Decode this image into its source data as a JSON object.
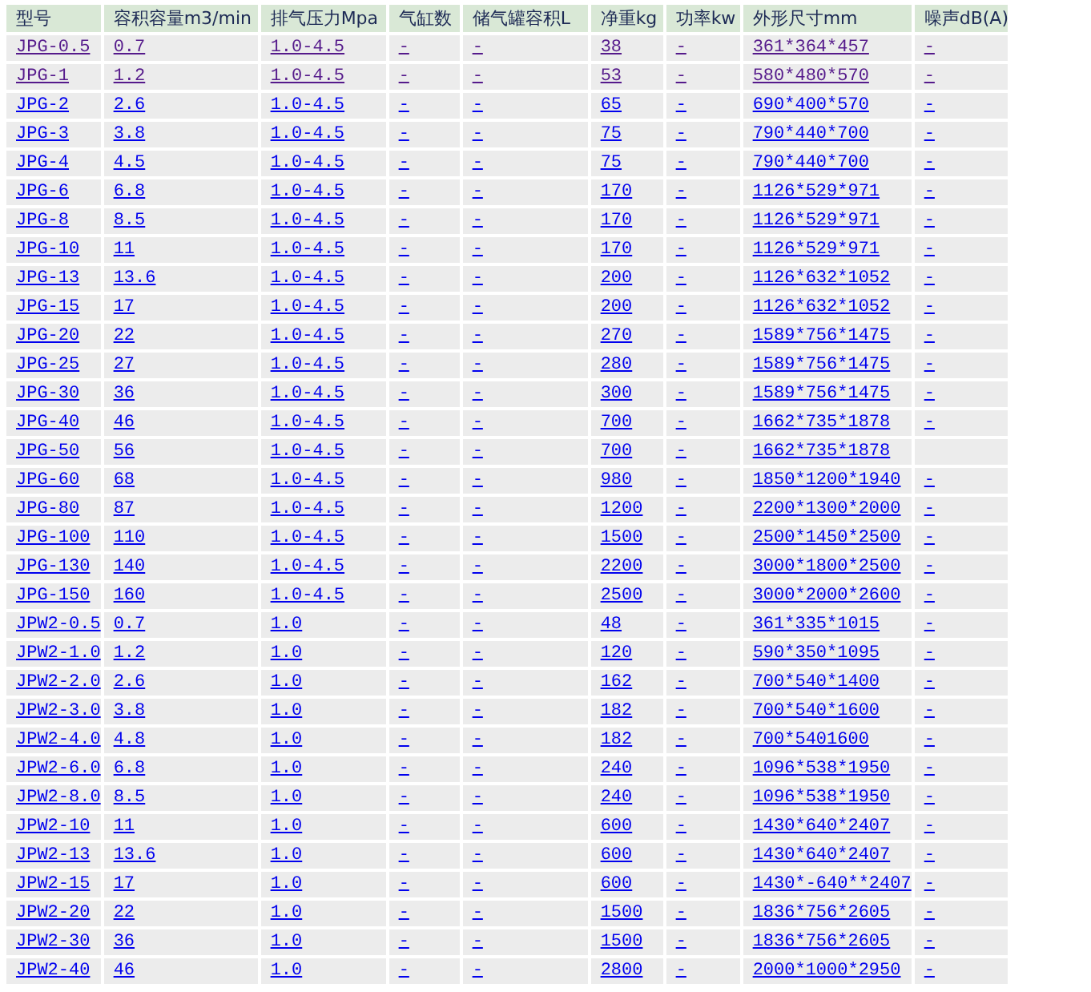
{
  "table": {
    "columns": [
      "型号",
      "容积容量m3/min",
      "排气压力Mpa",
      "气缸数",
      "储气罐容积L",
      "净重kg",
      "功率kw",
      "外形尺寸mm",
      "噪声dB(A)"
    ],
    "rows": [
      {
        "visited": true,
        "model": "JPG-0.5",
        "capacity": "0.7",
        "pressure": "1.0-4.5",
        "cylinders": "-",
        "tank": "-",
        "weight": "38",
        "power": "-",
        "dimensions": "361*364*457",
        "noise": "-"
      },
      {
        "visited": true,
        "model": "JPG-1",
        "capacity": "1.2",
        "pressure": "1.0-4.5",
        "cylinders": "-",
        "tank": "-",
        "weight": "53",
        "power": "-",
        "dimensions": "580*480*570",
        "noise": "-"
      },
      {
        "visited": false,
        "model": "JPG-2",
        "capacity": "2.6",
        "pressure": "1.0-4.5",
        "cylinders": "-",
        "tank": "-",
        "weight": "65",
        "power": "-",
        "dimensions": "690*400*570",
        "noise": "-"
      },
      {
        "visited": false,
        "model": "JPG-3",
        "capacity": "3.8",
        "pressure": "1.0-4.5",
        "cylinders": "-",
        "tank": "-",
        "weight": "75",
        "power": "-",
        "dimensions": "790*440*700",
        "noise": "-"
      },
      {
        "visited": false,
        "model": "JPG-4",
        "capacity": "4.5",
        "pressure": "1.0-4.5",
        "cylinders": "-",
        "tank": "-",
        "weight": "75",
        "power": "-",
        "dimensions": "790*440*700",
        "noise": "-"
      },
      {
        "visited": false,
        "model": "JPG-6",
        "capacity": "6.8",
        "pressure": "1.0-4.5",
        "cylinders": "-",
        "tank": "-",
        "weight": "170",
        "power": "-",
        "dimensions": "1126*529*971",
        "noise": "-"
      },
      {
        "visited": false,
        "model": "JPG-8",
        "capacity": "8.5",
        "pressure": "1.0-4.5",
        "cylinders": "-",
        "tank": "-",
        "weight": "170",
        "power": "-",
        "dimensions": "1126*529*971",
        "noise": "-"
      },
      {
        "visited": false,
        "model": "JPG-10",
        "capacity": "11",
        "pressure": "1.0-4.5",
        "cylinders": "-",
        "tank": "-",
        "weight": "170",
        "power": "-",
        "dimensions": "1126*529*971",
        "noise": "-"
      },
      {
        "visited": false,
        "model": "JPG-13",
        "capacity": "13.6",
        "pressure": "1.0-4.5",
        "cylinders": "-",
        "tank": "-",
        "weight": "200",
        "power": "-",
        "dimensions": "1126*632*1052",
        "noise": "-"
      },
      {
        "visited": false,
        "model": "JPG-15",
        "capacity": "17",
        "pressure": "1.0-4.5",
        "cylinders": "-",
        "tank": "-",
        "weight": "200",
        "power": "-",
        "dimensions": "1126*632*1052",
        "noise": "-"
      },
      {
        "visited": false,
        "model": "JPG-20",
        "capacity": "22",
        "pressure": "1.0-4.5",
        "cylinders": "-",
        "tank": "-",
        "weight": "270",
        "power": "-",
        "dimensions": "1589*756*1475",
        "noise": "-"
      },
      {
        "visited": false,
        "model": "JPG-25",
        "capacity": "27",
        "pressure": "1.0-4.5",
        "cylinders": "-",
        "tank": "-",
        "weight": "280",
        "power": "-",
        "dimensions": "1589*756*1475",
        "noise": "-"
      },
      {
        "visited": false,
        "model": "JPG-30",
        "capacity": "36",
        "pressure": "1.0-4.5",
        "cylinders": "-",
        "tank": "-",
        "weight": "300",
        "power": "-",
        "dimensions": "1589*756*1475",
        "noise": "-"
      },
      {
        "visited": false,
        "model": "JPG-40",
        "capacity": "46",
        "pressure": "1.0-4.5",
        "cylinders": "-",
        "tank": "-",
        "weight": "700",
        "power": "-",
        "dimensions": "1662*735*1878",
        "noise": "-"
      },
      {
        "visited": false,
        "model": "JPG-50",
        "capacity": "56",
        "pressure": "1.0-4.5",
        "cylinders": "-",
        "tank": "-",
        "weight": "700",
        "power": "-",
        "dimensions": "1662*735*1878"
      },
      {
        "visited": false,
        "model": "JPG-60",
        "capacity": "68",
        "pressure": "1.0-4.5",
        "cylinders": "-",
        "tank": "-",
        "weight": "980",
        "power": "-",
        "dimensions": "1850*1200*1940",
        "noise": "-"
      },
      {
        "visited": false,
        "model": "JPG-80",
        "capacity": "87",
        "pressure": "1.0-4.5",
        "cylinders": "-",
        "tank": "-",
        "weight": "1200",
        "power": "-",
        "dimensions": "2200*1300*2000",
        "noise": "-"
      },
      {
        "visited": false,
        "model": "JPG-100",
        "capacity": "110",
        "pressure": "1.0-4.5",
        "cylinders": "-",
        "tank": "-",
        "weight": "1500",
        "power": "-",
        "dimensions": "2500*1450*2500",
        "noise": "-"
      },
      {
        "visited": false,
        "model": "JPG-130",
        "capacity": "140",
        "pressure": "1.0-4.5",
        "cylinders": "-",
        "tank": "-",
        "weight": "2200",
        "power": "-",
        "dimensions": "3000*1800*2500",
        "noise": "-"
      },
      {
        "visited": false,
        "model": "JPG-150",
        "capacity": "160",
        "pressure": "1.0-4.5",
        "cylinders": "-",
        "tank": "-",
        "weight": "2500",
        "power": "-",
        "dimensions": "3000*2000*2600",
        "noise": "-"
      },
      {
        "visited": false,
        "model": "JPW2-0.5",
        "capacity": "0.7",
        "pressure": "1.0",
        "cylinders": "-",
        "tank": "-",
        "weight": "48",
        "power": "-",
        "dimensions": "361*335*1015",
        "noise": "-"
      },
      {
        "visited": false,
        "model": "JPW2-1.0",
        "capacity": "1.2",
        "pressure": "1.0",
        "cylinders": "-",
        "tank": "-",
        "weight": "120",
        "power": "-",
        "dimensions": "590*350*1095",
        "noise": "-"
      },
      {
        "visited": false,
        "model": "JPW2-2.0",
        "capacity": "2.6",
        "pressure": "1.0",
        "cylinders": "-",
        "tank": "-",
        "weight": "162",
        "power": "-",
        "dimensions": "700*540*1400",
        "noise": "-"
      },
      {
        "visited": false,
        "model": "JPW2-3.0",
        "capacity": "3.8",
        "pressure": "1.0",
        "cylinders": "-",
        "tank": "-",
        "weight": "182",
        "power": "-",
        "dimensions": "700*540*1600",
        "noise": "-"
      },
      {
        "visited": false,
        "model": "JPW2-4.0",
        "capacity": "4.8",
        "pressure": "1.0",
        "cylinders": "-",
        "tank": "-",
        "weight": "182",
        "power": "-",
        "dimensions": "700*5401600",
        "noise": "-"
      },
      {
        "visited": false,
        "model": "JPW2-6.0",
        "capacity": "6.8",
        "pressure": "1.0",
        "cylinders": "-",
        "tank": "-",
        "weight": "240",
        "power": "-",
        "dimensions": "1096*538*1950",
        "noise": "-"
      },
      {
        "visited": false,
        "model": "JPW2-8.0",
        "capacity": "8.5",
        "pressure": "1.0",
        "cylinders": "-",
        "tank": "-",
        "weight": "240",
        "power": "-",
        "dimensions": "1096*538*1950",
        "noise": "-"
      },
      {
        "visited": false,
        "model": "JPW2-10",
        "capacity": "11",
        "pressure": "1.0",
        "cylinders": "-",
        "tank": "-",
        "weight": "600",
        "power": "-",
        "dimensions": "1430*640*2407",
        "noise": "-"
      },
      {
        "visited": false,
        "model": "JPW2-13",
        "capacity": "13.6",
        "pressure": "1.0",
        "cylinders": "-",
        "tank": "-",
        "weight": "600",
        "power": "-",
        "dimensions": "1430*640*2407",
        "noise": "-"
      },
      {
        "visited": false,
        "model": "JPW2-15",
        "capacity": "17",
        "pressure": "1.0",
        "cylinders": "-",
        "tank": "-",
        "weight": "600",
        "power": "-",
        "dimensions": "1430*-640**2407",
        "noise": "-"
      },
      {
        "visited": false,
        "model": "JPW2-20",
        "capacity": "22",
        "pressure": "1.0",
        "cylinders": "-",
        "tank": "-",
        "weight": "1500",
        "power": "-",
        "dimensions": "1836*756*2605",
        "noise": "-"
      },
      {
        "visited": false,
        "model": "JPW2-30",
        "capacity": "36",
        "pressure": "1.0",
        "cylinders": "-",
        "tank": "-",
        "weight": "1500",
        "power": "-",
        "dimensions": "1836*756*2605",
        "noise": "-"
      },
      {
        "visited": false,
        "model": "JPW2-40",
        "capacity": "46",
        "pressure": "1.0",
        "cylinders": "-",
        "tank": "-",
        "weight": "2800",
        "power": "-",
        "dimensions": "2000*1000*2950",
        "noise": "-"
      }
    ]
  }
}
